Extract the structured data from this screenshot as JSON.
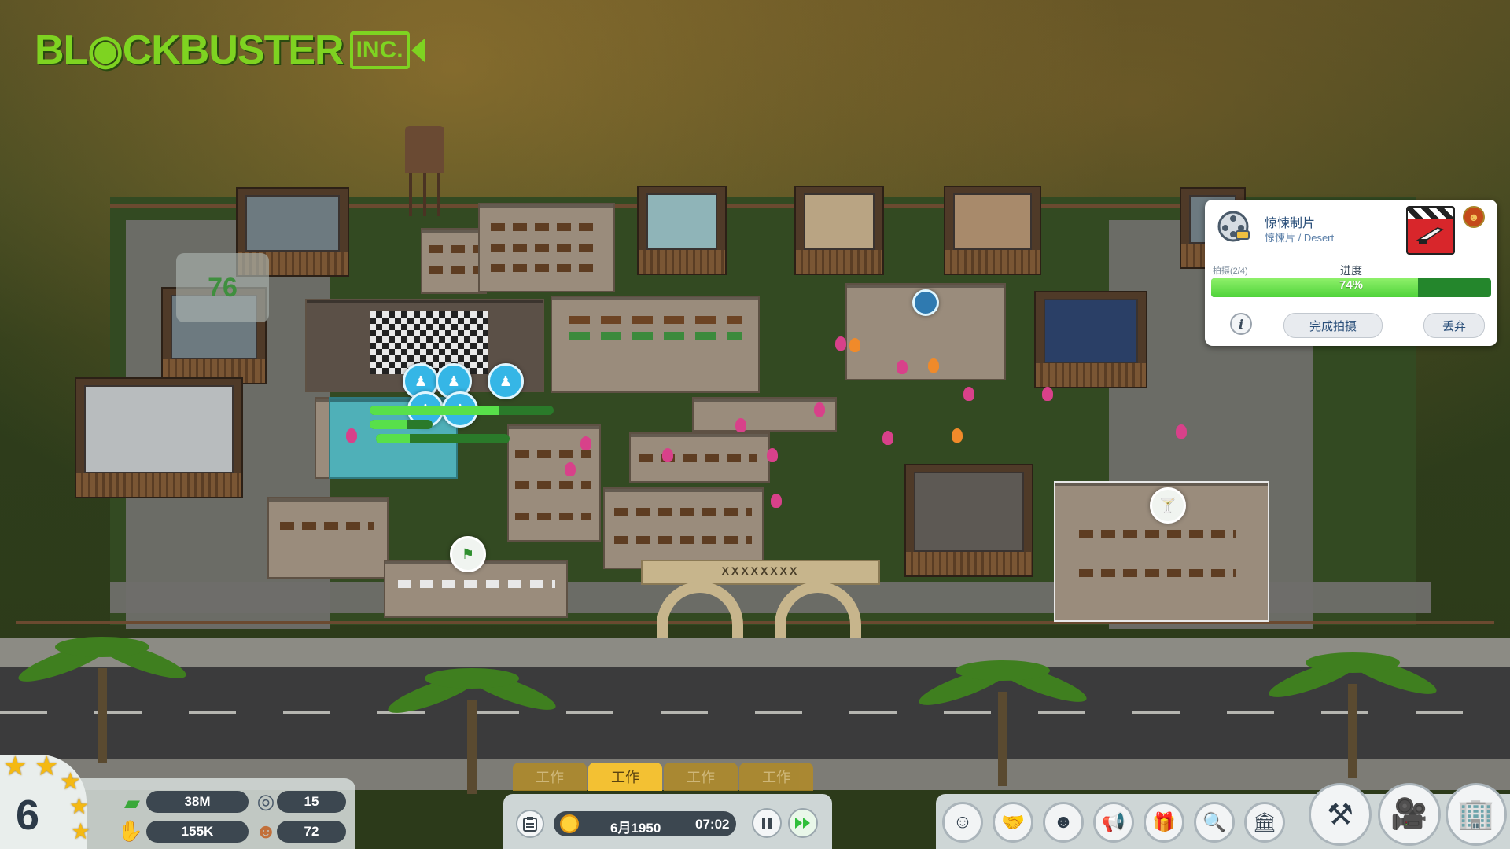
{
  "logo": {
    "main": "BL◉CKBUSTER",
    "inc": "INC."
  },
  "map": {
    "studio_score": "76",
    "gate_sign": "XXXXXXXX"
  },
  "production": {
    "title": "惊悚制片",
    "subtitle": "惊悚片 / Desert",
    "phase": "拍摄(2/4)",
    "progress_label": "进度",
    "progress_value": 74,
    "progress_text": "74%",
    "complete_button": "完成拍摄",
    "discard_button": "丢弃",
    "info_glyph": "i"
  },
  "stats": {
    "level": "6",
    "stars": 5,
    "money": "38M",
    "films": "15",
    "fans": "155K",
    "staff": "72"
  },
  "shifts": {
    "tabs": [
      "工作",
      "工作",
      "工作",
      "工作"
    ],
    "active_index": 1
  },
  "time": {
    "date": "6月1950",
    "clock": "07:02"
  },
  "menu": {
    "icons": [
      "staff-icon",
      "handshake-icon",
      "actors-icon",
      "megaphone-icon",
      "gift-icon",
      "search-document-icon",
      "bank-icon",
      "build-tools-icon",
      "film-camera-icon",
      "buildings-icon"
    ]
  },
  "colors": {
    "logo_green": "#7ed321",
    "progress_green": "#4fd33a",
    "shift_gold": "#f3c133",
    "panel_text_blue": "#2a4f7a"
  }
}
